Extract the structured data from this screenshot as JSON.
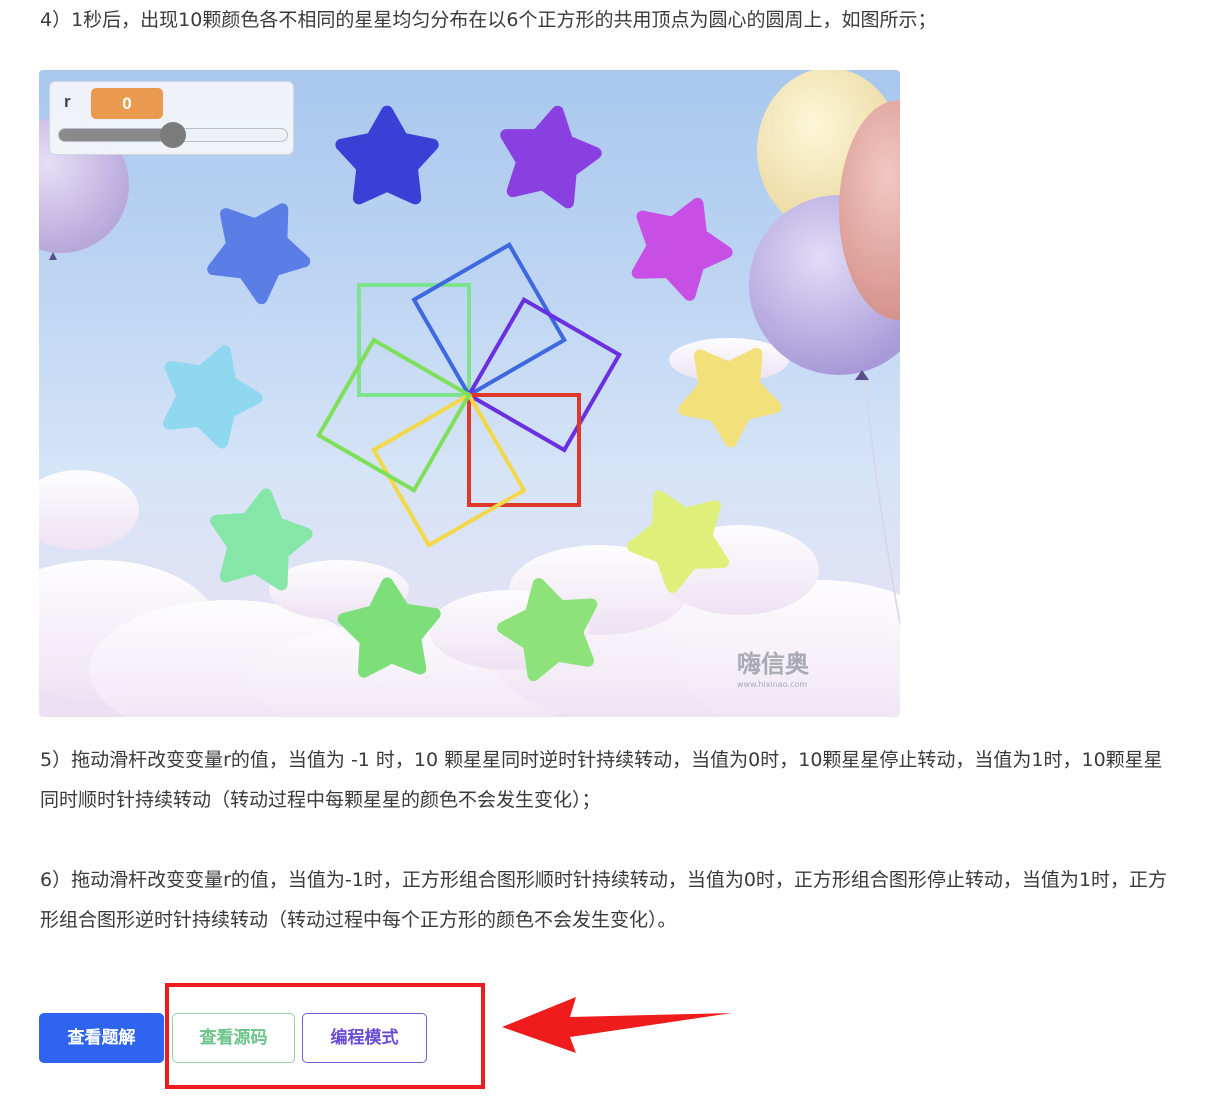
{
  "instructions": {
    "p4": "4）1秒后，出现10颗颜色各不相同的星星均匀分布在以6个正方形的共用顶点为圆心的圆周上，如图所示；",
    "p5": "5）拖动滑杆改变变量r的值，当值为 -1 时，10 颗星星同时逆时针持续转动，当值为0时，10颗星星停止转动，当值为1时，10颗星星同时顺时针持续转动（转动过程中每颗星星的颜色不会发生变化）；",
    "p6": "6）拖动滑杆改变变量r的值，当值为-1时，正方形组合图形顺时针持续转动，当值为0时，正方形组合图形停止转动，当值为1时，正方形组合图形逆时针持续转动（转动过程中每个正方形的颜色不会发生变化）。"
  },
  "stage": {
    "variable_monitor": {
      "label": "r",
      "value": "0",
      "value_color": "#e99a4e",
      "slider_fraction": 0.5
    },
    "star_colors": [
      "#3a3fd6",
      "#8a3fe0",
      "#c84fe6",
      "#f2e07a",
      "#dff07a",
      "#8de37a",
      "#7ddf7a",
      "#86e6a8",
      "#8fd8f0",
      "#5a7ee6"
    ],
    "square_colors": [
      "#7de38f",
      "#3d68e0",
      "#6a2fe0",
      "#e0392a",
      "#f2d84a",
      "#7ee05a"
    ],
    "watermark": "嗨信奥"
  },
  "buttons": {
    "solution": "查看题解",
    "source": "查看源码",
    "code_mode": "编程模式"
  },
  "annotation": {
    "highlight_color": "#ee1c1c"
  }
}
